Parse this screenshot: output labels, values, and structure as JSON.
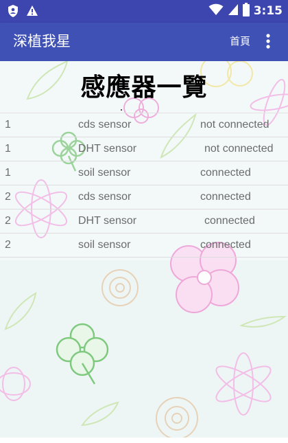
{
  "status_bar": {
    "time": "3:15",
    "icons": [
      "shield-icon",
      "warning-icon",
      "wifi-icon",
      "cell-signal-icon",
      "battery-icon"
    ]
  },
  "app_bar": {
    "title": "深植我星",
    "home_label": "首頁",
    "menu_icon": "more-vert-icon",
    "color": "#3f51b5",
    "status_color": "#3d45ae"
  },
  "main": {
    "heading": "感應器一覽"
  },
  "sensors": [
    {
      "id": "1",
      "name": "cds sensor",
      "status": "not connected"
    },
    {
      "id": "1",
      "name": "DHT sensor",
      "status": "not connected"
    },
    {
      "id": "1",
      "name": "soil sensor",
      "status": "connected"
    },
    {
      "id": "2",
      "name": "cds sensor",
      "status": "connected"
    },
    {
      "id": "2",
      "name": "DHT sensor",
      "status": "connected"
    },
    {
      "id": "2",
      "name": "soil sensor",
      "status": "connected"
    }
  ]
}
